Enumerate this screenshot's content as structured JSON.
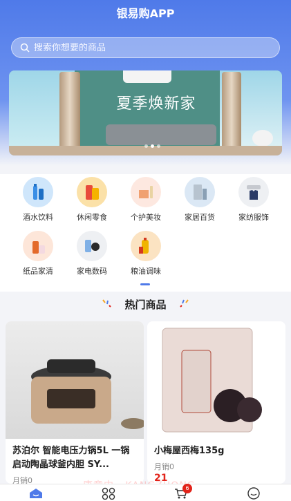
{
  "app": {
    "title": "银易购APP"
  },
  "search": {
    "placeholder": "搜索你想要的商品"
  },
  "banner": {
    "title": "夏季焕新家"
  },
  "categories": [
    {
      "label": "酒水饮料",
      "icon": "drinks-icon"
    },
    {
      "label": "休闲零食",
      "icon": "snacks-icon"
    },
    {
      "label": "个护美妆",
      "icon": "cosmetics-icon"
    },
    {
      "label": "家居百货",
      "icon": "home-goods-icon"
    },
    {
      "label": "家纺服饰",
      "icon": "apparel-icon"
    },
    {
      "label": "纸品家清",
      "icon": "cleaning-icon"
    },
    {
      "label": "家电数码",
      "icon": "electronics-icon"
    },
    {
      "label": "粮油调味",
      "icon": "grain-oil-icon"
    }
  ],
  "hot": {
    "title": "热门商品"
  },
  "products": [
    {
      "name": "苏泊尔 智能电压力锅5L 一锅启动陶晶球釜内胆 SY...",
      "sales": "月销0"
    },
    {
      "name": "小梅屋西梅135g",
      "sales": "月销0",
      "price_partial": "21"
    }
  ],
  "tabbar": {
    "items": [
      "home-icon",
      "category-icon",
      "cart-icon",
      "profile-icon"
    ],
    "cart_badge": "6"
  },
  "watermark": "康章中 · KANGZHONG",
  "colors": {
    "primary": "#4f7ae9",
    "price": "#e2231a",
    "badge": "#e2231a"
  }
}
